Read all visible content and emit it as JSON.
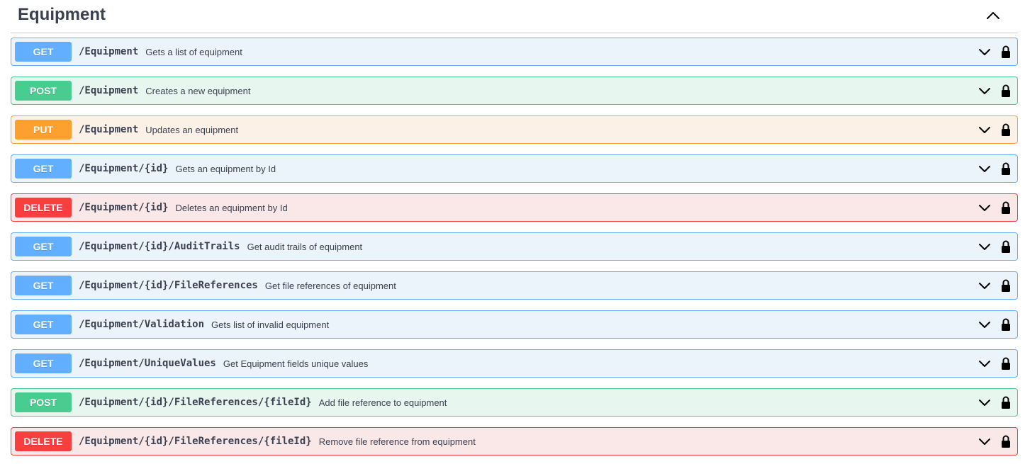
{
  "section": {
    "title": "Equipment",
    "toggle_icon": "chevron-up-icon"
  },
  "method_colors": {
    "GET": "#61affe",
    "POST": "#49cc90",
    "PUT": "#fca130",
    "DELETE": "#f93e3e"
  },
  "operations": [
    {
      "method": "GET",
      "path": "/Equipment",
      "summary": "Gets a list of equipment"
    },
    {
      "method": "POST",
      "path": "/Equipment",
      "summary": "Creates a new equipment"
    },
    {
      "method": "PUT",
      "path": "/Equipment",
      "summary": "Updates an equipment"
    },
    {
      "method": "GET",
      "path": "/Equipment/{id}",
      "summary": "Gets an equipment by Id"
    },
    {
      "method": "DELETE",
      "path": "/Equipment/{id}",
      "summary": "Deletes an equipment by Id"
    },
    {
      "method": "GET",
      "path": "/Equipment/{id}/AuditTrails",
      "summary": "Get audit trails of equipment"
    },
    {
      "method": "GET",
      "path": "/Equipment/{id}/FileReferences",
      "summary": "Get file references of equipment"
    },
    {
      "method": "GET",
      "path": "/Equipment/Validation",
      "summary": "Gets list of invalid equipment"
    },
    {
      "method": "GET",
      "path": "/Equipment/UniqueValues",
      "summary": "Get Equipment fields unique values"
    },
    {
      "method": "POST",
      "path": "/Equipment/{id}/FileReferences/{fileId}",
      "summary": "Add file reference to equipment"
    },
    {
      "method": "DELETE",
      "path": "/Equipment/{id}/FileReferences/{fileId}",
      "summary": "Remove file reference from equipment"
    }
  ]
}
